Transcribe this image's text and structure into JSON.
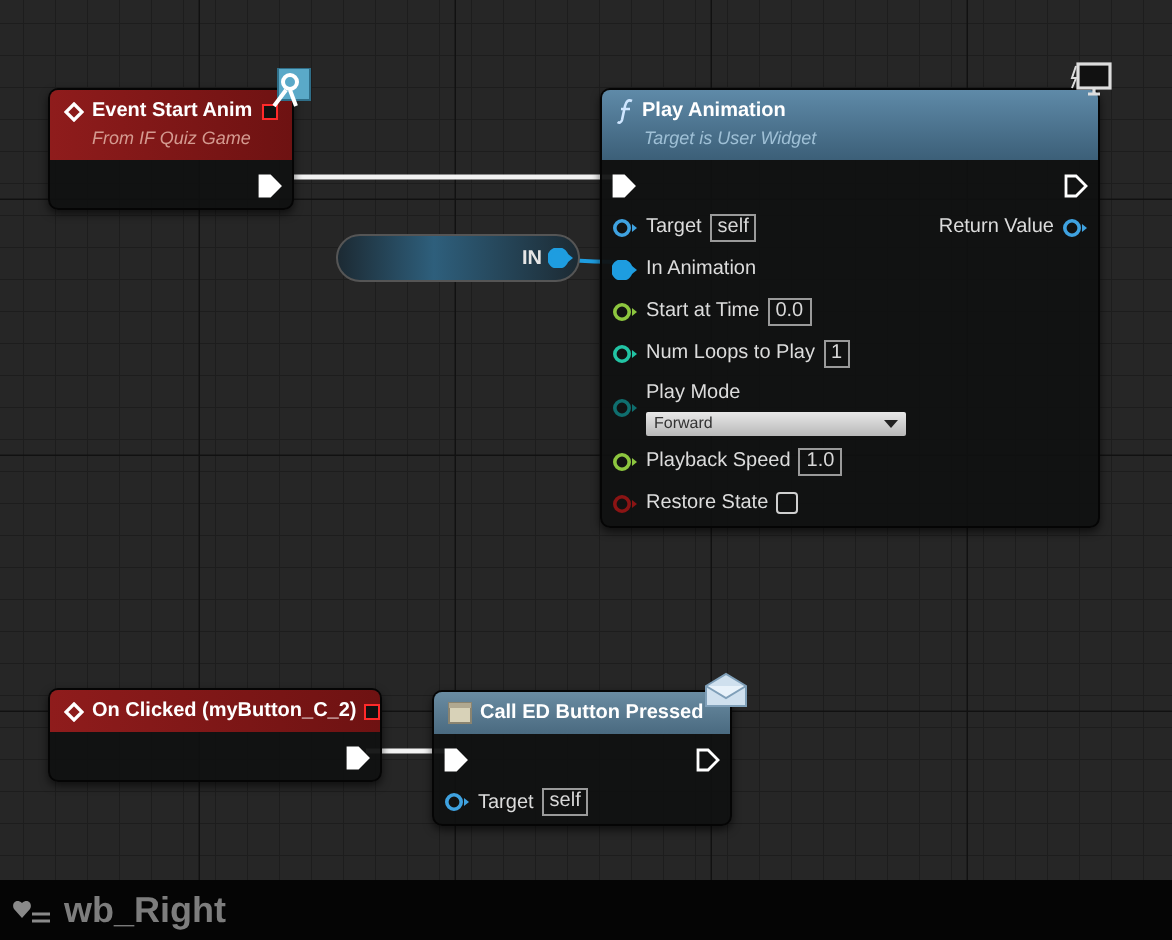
{
  "nodes": [
    {
      "kind": "event",
      "title": "Event Start Anim",
      "subtitle": "From IF Quiz Game",
      "delegate": true,
      "badge": true,
      "outputs": [
        {
          "kind": "exec",
          "connected": true
        }
      ]
    },
    {
      "kind": "function",
      "title": "Play Animation",
      "subtitle": "Target is User Widget",
      "badge": true,
      "inputs": [
        {
          "kind": "exec",
          "connected": true
        },
        {
          "kind": "data",
          "label": "Target",
          "color": "#3fa2e0",
          "connected": false,
          "default": {
            "kind": "text",
            "value": "self"
          }
        },
        {
          "kind": "data",
          "label": "In Animation",
          "color": "#1e9de0",
          "connected": true
        },
        {
          "kind": "data",
          "label": "Start at Time",
          "color": "#8dc63f",
          "connected": false,
          "default": {
            "kind": "text",
            "value": "0.0"
          }
        },
        {
          "kind": "data",
          "label": "Num Loops to Play",
          "color": "#22c4a4",
          "connected": false,
          "default": {
            "kind": "text",
            "value": "1"
          }
        },
        {
          "kind": "data",
          "label": "Play Mode",
          "color": "#0f6e6e",
          "connected": false,
          "default": {
            "kind": "dropdown",
            "value": "Forward"
          }
        },
        {
          "kind": "data",
          "label": "Playback Speed",
          "color": "#8dc63f",
          "connected": false,
          "default": {
            "kind": "text",
            "value": "1.0"
          }
        },
        {
          "kind": "data",
          "label": "Restore State",
          "color": "#8b1414",
          "connected": false,
          "default": {
            "kind": "checkbox",
            "checked": false
          }
        }
      ],
      "outputs": [
        {
          "kind": "exec",
          "connected": false
        },
        {
          "kind": "data",
          "label": "Return Value",
          "color": "#3fa2e0",
          "connected": false
        }
      ]
    },
    {
      "kind": "variable",
      "title": "IN",
      "outputs": [
        {
          "kind": "data",
          "color": "#1e9de0",
          "connected": true
        }
      ]
    },
    {
      "kind": "event",
      "title": "On Clicked (myButton_C_2)",
      "delegate": true,
      "outputs": [
        {
          "kind": "exec",
          "connected": true
        }
      ]
    },
    {
      "kind": "message",
      "title": "Call ED Button Pressed",
      "badge": true,
      "inputs": [
        {
          "kind": "exec",
          "connected": true
        },
        {
          "kind": "data",
          "label": "Target",
          "color": "#3fa2e0",
          "connected": false,
          "default": {
            "kind": "text",
            "value": "self"
          }
        }
      ],
      "outputs": [
        {
          "kind": "exec",
          "connected": false
        }
      ]
    }
  ],
  "tab": {
    "title": "wb_Right"
  }
}
